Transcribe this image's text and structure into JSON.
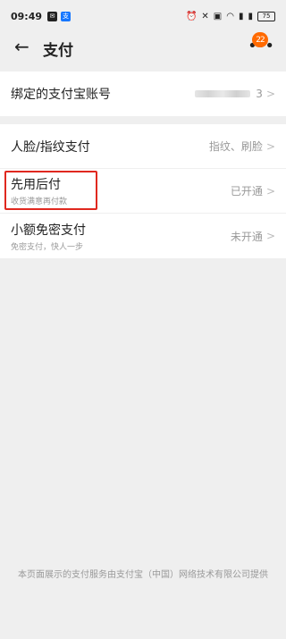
{
  "status": {
    "time": "09:49",
    "battery": "75"
  },
  "header": {
    "title": "支付",
    "back_icon": "←",
    "more_icon": "•••",
    "badge": "22"
  },
  "alipay": {
    "label": "绑定的支付宝账号",
    "masked_tail": "3"
  },
  "rows": [
    {
      "label": "人脸/指纹支付",
      "sub": "",
      "value": "指纹、刷脸"
    },
    {
      "label": "先用后付",
      "sub": "收货满意再付款",
      "value": "已开通"
    },
    {
      "label": "小额免密支付",
      "sub": "免密支付，快人一步",
      "value": "未开通"
    }
  ],
  "highlight_color": "#e0281f",
  "footer": "本页面展示的支付服务由支付宝（中国）网络技术有限公司提供"
}
